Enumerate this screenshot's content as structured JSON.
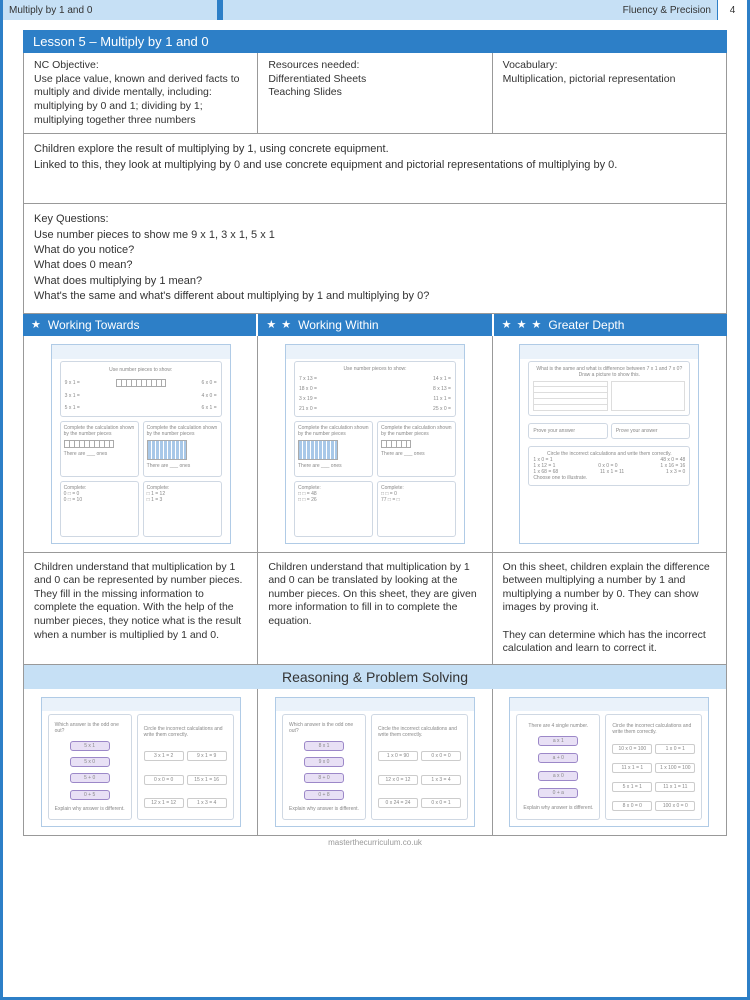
{
  "header": {
    "topic": "Multiply by 1 and 0",
    "strand": "Fluency & Precision",
    "page": "4"
  },
  "lesson": {
    "title": "Lesson 5 – Multiply by 1 and 0",
    "objective_label": "NC Objective:",
    "objective": "Use place value, known and derived facts to multiply and divide mentally, including: multiplying by 0 and 1; dividing by 1; multiplying together three numbers",
    "resources_label": "Resources needed:",
    "resources": "Differentiated Sheets\nTeaching Slides",
    "vocab_label": "Vocabulary:",
    "vocab": "Multiplication, pictorial representation"
  },
  "overview": "Children explore the result of multiplying by 1, using concrete equipment.\nLinked to this, they look at multiplying by 0 and use concrete equipment and pictorial representations of multiplying by 0.",
  "key_questions": {
    "label": "Key Questions:",
    "q1": "Use number pieces to show me 9 x 1, 3 x 1, 5 x 1",
    "q2": "What do you notice?",
    "q3": "What does 0 mean?",
    "q4": "What does multiplying by 1 mean?",
    "q5": "What's the same and what's different about multiplying by 1 and multiplying by 0?"
  },
  "tiers": {
    "wt": "Working Towards",
    "ww": "Working Within",
    "gd": "Greater Depth"
  },
  "descriptions": {
    "wt": "Children understand that multiplication by 1 and 0 can be represented by number pieces. They fill in the missing information to complete the equation. With the help of the number pieces, they notice what is the result when a number is multiplied by 1 and 0.",
    "ww": "Children understand that multiplication by 1 and 0 can be translated by looking at the number pieces. On this sheet, they are given more information to fill in to complete the equation.",
    "gd": "On this sheet, children explain the difference between multiplying a number by 1 and multiplying a number by 0. They can show images by proving it.\n\nThey can determine which has the incorrect calculation and learn to correct it."
  },
  "rps_title": "Reasoning & Problem Solving",
  "footer": "masterthecurriculum.co.uk",
  "thumb_text": {
    "use_pieces": "Use number pieces to show:",
    "complete_calc": "Complete the calculation shown by the number pieces",
    "complete": "Complete:",
    "there_are": "There are ___ ones",
    "wt_eq1": "9 x 1 =",
    "wt_eq2": "6 x 0 =",
    "wt_eq3": "3 x 1 =",
    "wt_eq4": "4 x 0 =",
    "wt_eq5": "5 x 1 =",
    "wt_eq6": "6 x 1 =",
    "ww_eq1": "7 x 13 =",
    "ww_eq2": "14 x 1 =",
    "ww_eq3": "18 x 0 =",
    "ww_eq4": "8 x 13 =",
    "ww_eq5": "3 x 19 =",
    "ww_eq6": "11 x 1 =",
    "ww_eq7": "21 x 0 =",
    "ww_eq8": "25 x 0 =",
    "gd_q": "What is the same and what is difference between 7 x 1 and 7 x 0?",
    "gd_draw": "Draw a picture to show this.",
    "gd_prove": "Prove your answer",
    "gd_circle": "Circle the incorrect calculations and write them correctly.",
    "gd_c1": "1 x 0 = 1",
    "gd_c2": "48 x 0 = 48",
    "gd_c3": "1 x 12 = 1",
    "gd_c4": "0 x 0 = 0",
    "gd_c5": "1 x 16 = 16",
    "gd_c6": "1 x 68 = 68",
    "gd_c7": "11 x 1 = 11",
    "gd_c8": "1 x 3 = 0",
    "gd_choose": "Choose one to illustrate.",
    "odd_one": "Which answer is the odd one out?",
    "circle_inc": "Circle the incorrect calculations and write them correctly.",
    "explain": "Explain why answer is different.",
    "p1": "5 x 1",
    "p2": "5 x 0",
    "p3": "5 + 0",
    "p4": "0 + 5",
    "r1": "3 x 1 = 2",
    "r2": "9 x 1 = 9",
    "r3": "0 x 0 = 0",
    "r4": "15 x 1 = 16",
    "r5": "12 x 1 = 12",
    "r6": "1 x 3 = 4",
    "p5": "8 x 1",
    "p6": "9 x 0",
    "p7": "8 + 0",
    "p8": "0 + 8",
    "r7": "1 x 0 = 90",
    "r8": "0 x 0 = 0",
    "r9": "12 x 0 = 12",
    "r10": "1 x 3 = 4",
    "r11": "0 x 24 = 24",
    "r12": "0 x 0 = 1",
    "p9": "a x 1",
    "p10": "a + 0",
    "p11": "a x 0",
    "p12": "0 + a",
    "r13": "10 x 0 = 100",
    "r14": "1 x 0 = 1",
    "r15": "11 x 1 = 1",
    "r16": "1 x 100 = 100",
    "r17": "5 x 1 = 1",
    "r18": "11 x 1 = 11",
    "r19": "8 x 0 = 0",
    "r20": "100 x 0 = 0"
  }
}
